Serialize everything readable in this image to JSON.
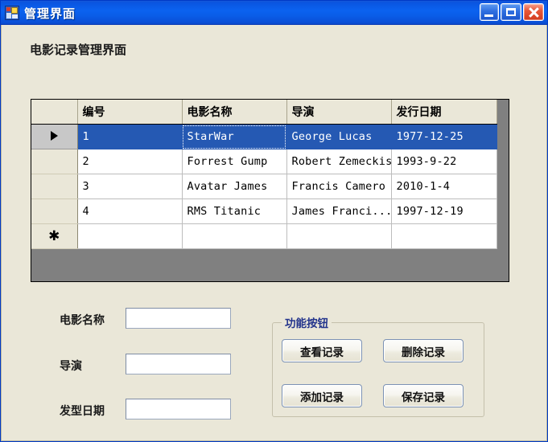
{
  "window": {
    "title": "管理界面",
    "icon": "form-designer-icon",
    "caption_buttons": [
      {
        "name": "minimize-button",
        "glyph": "minimize-icon"
      },
      {
        "name": "maximize-button",
        "glyph": "maximize-icon"
      },
      {
        "name": "close-button",
        "glyph": "close-icon"
      }
    ],
    "colors": {
      "titlebar_blue": "#0b62f0",
      "client_background": "#eae7d8",
      "selection_blue": "#2559b3",
      "close_red": "#e8593a",
      "groupbox_title": "#23348c"
    }
  },
  "main": {
    "heading": "电影记录管理界面"
  },
  "grid": {
    "row_header_selected_marker": "▶",
    "row_header_new_marker": "✱",
    "columns": [
      "编号",
      "电影名称",
      "导演",
      "发行日期"
    ],
    "rows": [
      {
        "marker": "arrow",
        "selected": true,
        "cells": [
          "1",
          "StarWar",
          "George Lucas",
          "1977-12-25"
        ]
      },
      {
        "marker": "",
        "selected": false,
        "cells": [
          "2",
          "Forrest Gump",
          "Robert Zemeckis",
          "1993-9-22"
        ]
      },
      {
        "marker": "",
        "selected": false,
        "cells": [
          "3",
          "Avatar James",
          "Francis Camero",
          "2010-1-4"
        ]
      },
      {
        "marker": "",
        "selected": false,
        "cells": [
          "4",
          "RMS Titanic",
          "James Franci...",
          "1997-12-19"
        ]
      },
      {
        "marker": "star",
        "selected": false,
        "cells": [
          "",
          "",
          "",
          ""
        ]
      }
    ]
  },
  "form": {
    "fields": [
      {
        "label": "电影名称",
        "value": "",
        "placeholder": ""
      },
      {
        "label": "导演",
        "value": "",
        "placeholder": ""
      },
      {
        "label": "发型日期",
        "value": "",
        "placeholder": ""
      }
    ]
  },
  "groupbox": {
    "title": "功能按钮",
    "buttons": [
      {
        "label": "查看记录"
      },
      {
        "label": "删除记录"
      },
      {
        "label": "添加记录"
      },
      {
        "label": "保存记录"
      }
    ]
  }
}
